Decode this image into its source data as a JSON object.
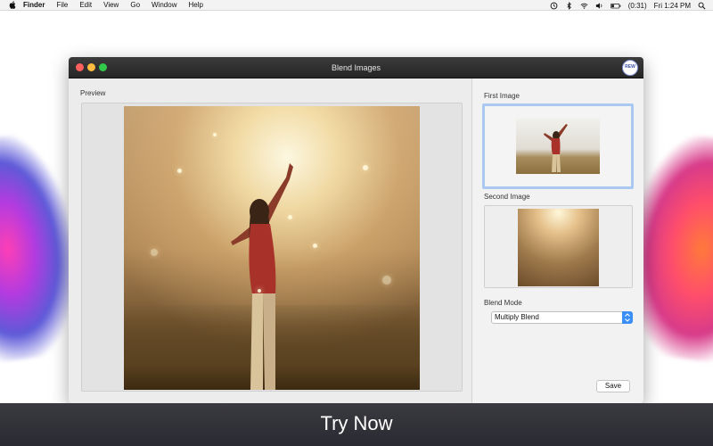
{
  "menubar": {
    "items": [
      "Finder",
      "File",
      "Edit",
      "View",
      "Go",
      "Window",
      "Help"
    ],
    "battery": "(0:31)",
    "clock": "Fri 1:24 PM"
  },
  "window": {
    "title": "Blend Images",
    "badge": "REW"
  },
  "preview": {
    "label": "Preview"
  },
  "sidebar": {
    "first_image_label": "First Image",
    "second_image_label": "Second Image",
    "blend_mode_label": "Blend Mode",
    "blend_mode_value": "Multiply Blend",
    "save_label": "Save"
  },
  "banner": {
    "text": "Try Now"
  },
  "colors": {
    "selection_border": "#a9c8f2",
    "popup_accent": "#3b8ef5",
    "banner_bg": "#2a2b32"
  }
}
